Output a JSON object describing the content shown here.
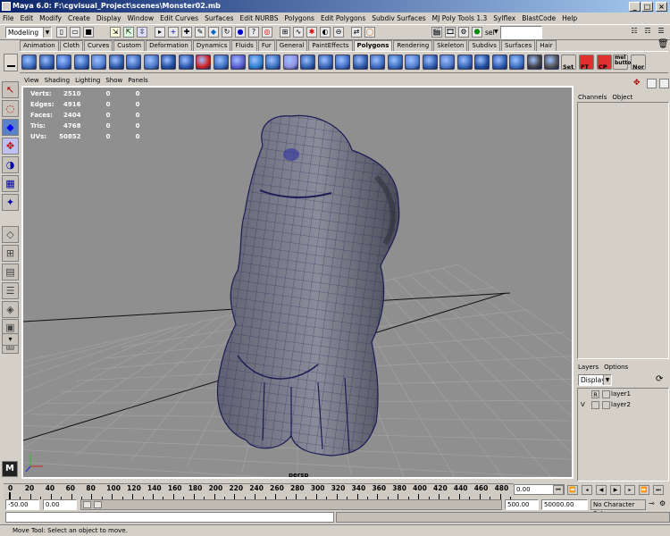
{
  "window": {
    "title": "Maya 6.0: F:\\cgvisual_Project\\scenes\\Monster02.mb"
  },
  "menubar": [
    "File",
    "Edit",
    "Modify",
    "Create",
    "Display",
    "Window",
    "Edit Curves",
    "Surfaces",
    "Edit NURBS",
    "Polygons",
    "Edit Polygons",
    "Subdiv Surfaces",
    "MJ Poly Tools 1.3",
    "Sylflex",
    "BlastCode",
    "Help"
  ],
  "statusline": {
    "menu_set": "Modeling",
    "sel_label": "sel"
  },
  "shelf": {
    "tabs": [
      "Animation",
      "Cloth",
      "Curves",
      "Custom",
      "Deformation",
      "Dynamics",
      "Fluids",
      "Fur",
      "General",
      "PaintEffects",
      "Polygons",
      "Rendering",
      "Skeleton",
      "Subdivs",
      "Surfaces",
      "Hair"
    ],
    "active_tab": "Polygons",
    "icon_labels": [
      "Set",
      "FT",
      "CP",
      "mel button",
      "Nor"
    ]
  },
  "viewport": {
    "menu": [
      "View",
      "Shading",
      "Lighting",
      "Show",
      "Panels"
    ],
    "camera": "persp",
    "hud": [
      {
        "label": "Verts:",
        "v1": "2510",
        "v2": "0",
        "v3": "0"
      },
      {
        "label": "Edges:",
        "v1": "4916",
        "v2": "0",
        "v3": "0"
      },
      {
        "label": "Faces:",
        "v1": "2404",
        "v2": "0",
        "v3": "0"
      },
      {
        "label": "Tris:",
        "v1": "4768",
        "v2": "0",
        "v3": "0"
      },
      {
        "label": "UVs:",
        "v1": "50852",
        "v2": "0",
        "v3": "0"
      }
    ]
  },
  "channel_box": {
    "tabs": [
      "Channels",
      "Object"
    ]
  },
  "layer_editor": {
    "tabs": [
      "Layers",
      "Options"
    ],
    "display_mode": "Display",
    "layers": [
      {
        "flag_v": "",
        "flag_r": "R",
        "name": "layer1"
      },
      {
        "flag_v": "V",
        "flag_r": "",
        "name": "layer2"
      }
    ]
  },
  "timeline": {
    "ticks": [
      "20",
      "40",
      "60",
      "80",
      "100",
      "120",
      "140",
      "160",
      "180",
      "200",
      "220",
      "240",
      "260",
      "280",
      "300",
      "320",
      "340",
      "360",
      "380",
      "400",
      "420",
      "440",
      "460",
      "480"
    ],
    "start_marker": "0",
    "current_frame": "0.00"
  },
  "range": {
    "start": "-50.00",
    "playback_start": "0.00",
    "playback_end": "500.00",
    "end": "50000.00",
    "character_set": "No Character Set"
  },
  "help_line": "Move Tool: Select an object to move."
}
